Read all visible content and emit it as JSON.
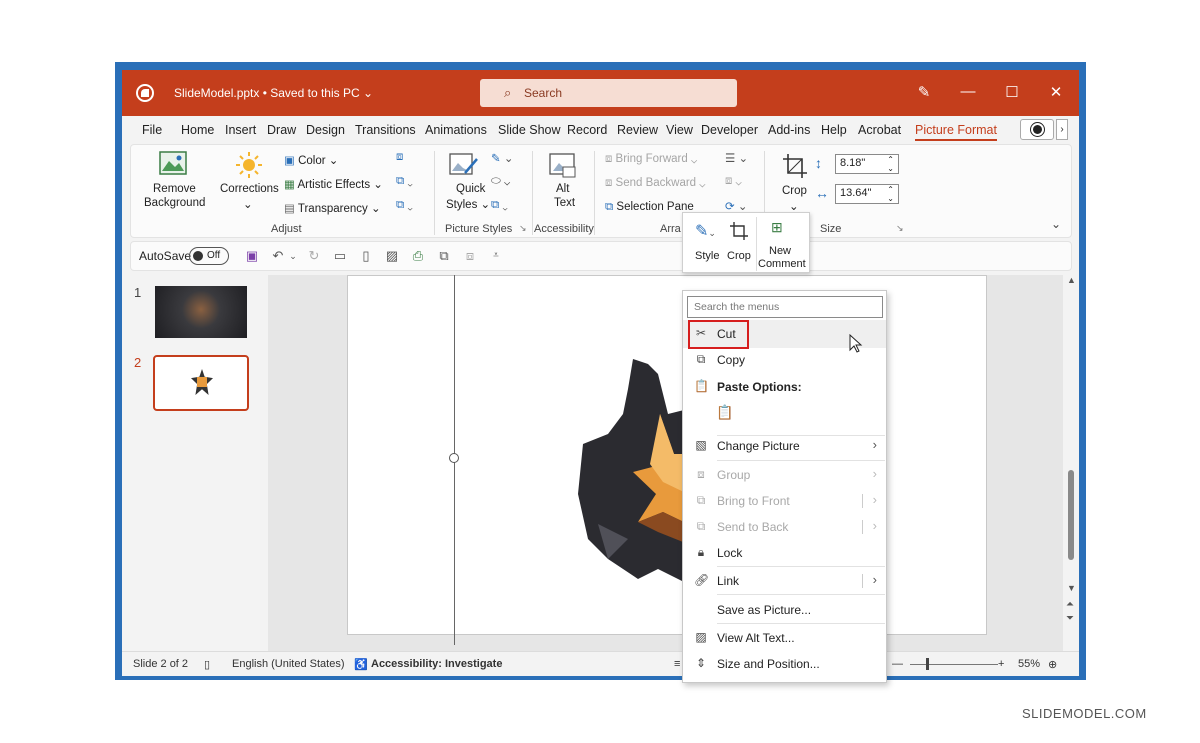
{
  "window": {
    "doc_title": "SlideModel.pptx • Saved to this PC ⌄",
    "search_label": "Search"
  },
  "tabs": [
    "File",
    "Home",
    "Insert",
    "Draw",
    "Design",
    "Transitions",
    "Animations",
    "Slide Show",
    "Record",
    "Review",
    "View",
    "Developer",
    "Add-ins",
    "Help",
    "Acrobat",
    "Picture Format"
  ],
  "ribbon": {
    "adjust": {
      "remove_bg": [
        "Remove",
        "Background"
      ],
      "corrections": "Corrections",
      "color": "Color ⌄",
      "artistic": "Artistic Effects ⌄",
      "transparency": "Transparency ⌄",
      "label": "Adjust"
    },
    "picture_styles": {
      "quick": [
        "Quick",
        "Styles ⌄"
      ],
      "label": "Picture Styles"
    },
    "accessibility": {
      "alt": [
        "Alt",
        "Text"
      ],
      "label": "Accessibility"
    },
    "arrange": {
      "bring_forward": "Bring Forward",
      "send_backward": "Send Backward",
      "selection_pane": "Selection Pane",
      "label": "Arra"
    },
    "size": {
      "crop": "Crop",
      "height": "8.18\"",
      "width": "13.64\"",
      "label": "Size"
    }
  },
  "qat": {
    "autosave": "AutoSave",
    "toggle": "Off"
  },
  "slides": {
    "n1": "1",
    "n2": "2"
  },
  "minibar": {
    "style": "Style",
    "crop": "Crop",
    "new_comment": [
      "New",
      "Comment"
    ]
  },
  "context_menu": {
    "search_placeholder": "Search the menus",
    "cut": "Cut",
    "copy": "Copy",
    "paste_options": "Paste Options:",
    "change_picture": "Change Picture",
    "group": "Group",
    "bring_to_front": "Bring to Front",
    "send_to_back": "Send to Back",
    "lock": "Lock",
    "link": "Link",
    "save_as_picture": "Save as Picture...",
    "view_alt_text": "View Alt Text...",
    "size_position": "Size and Position..."
  },
  "status": {
    "slide": "Slide 2 of 2",
    "language": "English (United States)",
    "accessibility": "Accessibility: Investigate",
    "zoom": "55%"
  },
  "watermark": "SLIDEMODEL.COM",
  "colors": {
    "accent": "#c43e1c",
    "highlight": "#d61e1e"
  }
}
